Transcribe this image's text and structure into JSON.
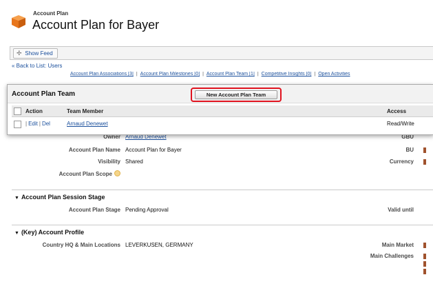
{
  "header": {
    "object_type": "Account Plan",
    "title": "Account Plan for Bayer"
  },
  "feed": {
    "show_feed_label": "Show Feed"
  },
  "back_link": "« Back to List: Users",
  "related_links": [
    "Account Plan Associations [3]",
    "Account Plan Milestones [0]",
    "Account Plan Team [1]",
    "Competitive Insights [0]",
    "Open Activities"
  ],
  "team_panel": {
    "title": "Account Plan Team",
    "new_button": "New Account Plan Team",
    "columns": {
      "action": "Action",
      "member": "Team Member",
      "access": "Access"
    },
    "rows": [
      {
        "edit": "Edit",
        "delete": "Del",
        "member": "Arnaud Denewet",
        "access": "Read/Write"
      }
    ]
  },
  "details": {
    "owner_label": "Owner",
    "owner_value": "Arnaud Denewet",
    "name_label": "Account Plan Name",
    "name_value": "Account Plan for Bayer",
    "visibility_label": "Visibility",
    "visibility_value": "Shared",
    "scope_label": "Account Plan Scope",
    "gbu_label": "GBU",
    "bu_label": "BU",
    "currency_label": "Currency"
  },
  "session_stage": {
    "title": "Account Plan Session Stage",
    "stage_label": "Account Plan Stage",
    "stage_value": "Pending Approval",
    "valid_until_label": "Valid until"
  },
  "key_profile": {
    "title": "(Key) Account Profile",
    "country_label": "Country HQ & Main Locations",
    "country_value": "LEVERKUSEN, GERMANY",
    "main_market_label": "Main Market",
    "main_challenges_label": "Main Challenges"
  },
  "colors": {
    "link": "#1a4f9c",
    "highlight": "#e0121e",
    "icon_orange": "#e8761c"
  }
}
